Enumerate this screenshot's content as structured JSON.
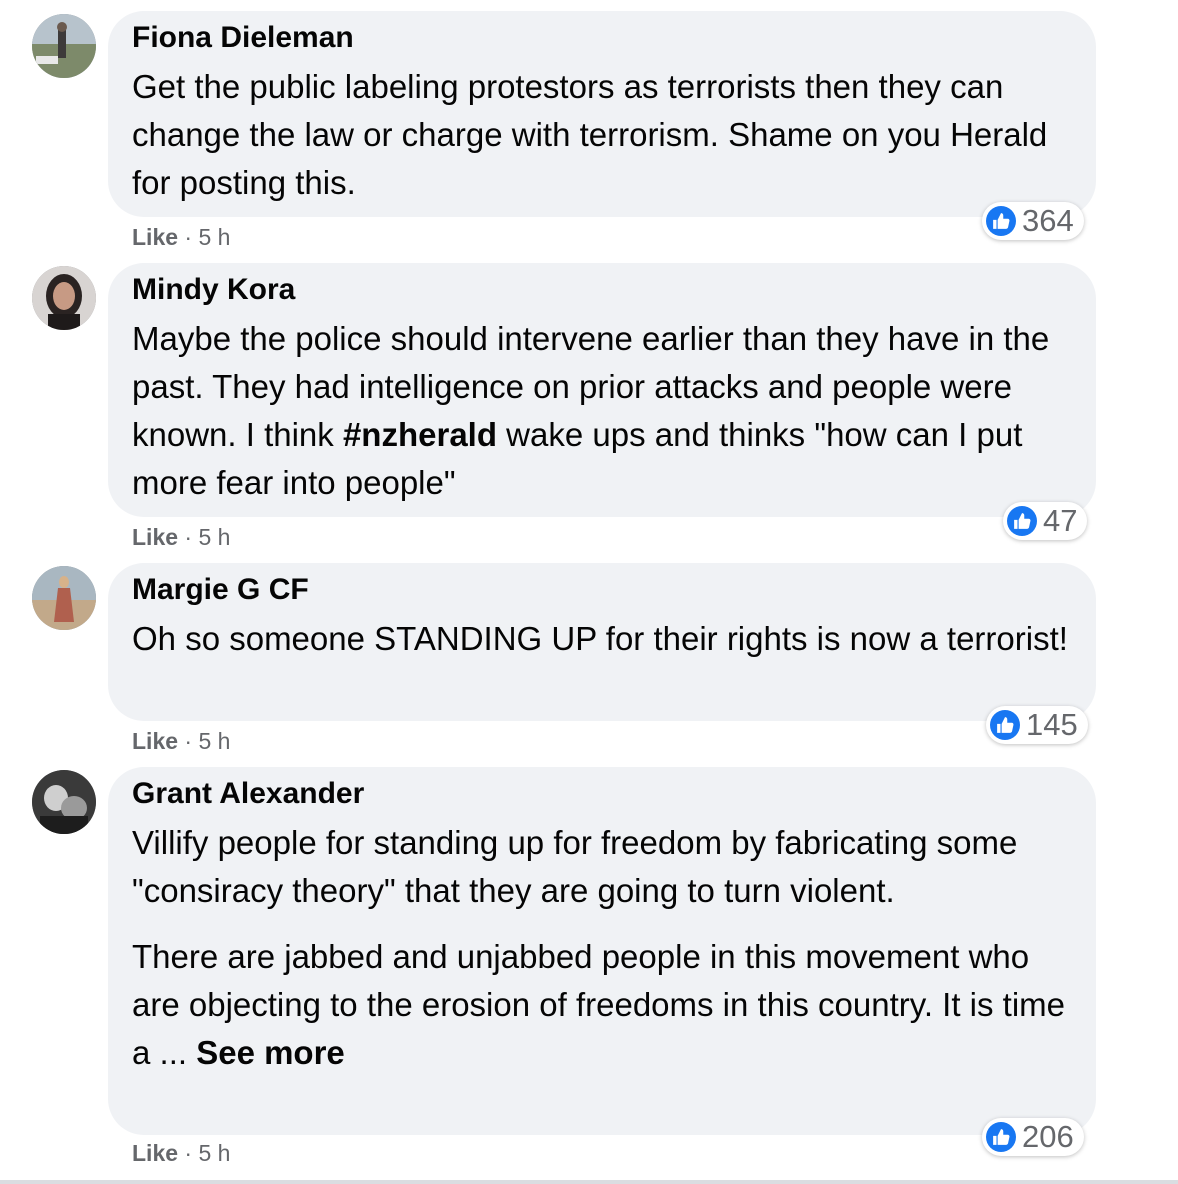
{
  "comments": [
    {
      "author": "Fiona Dieleman",
      "text": "Get the public labeling protestors as terrorists then they can change the law or charge with terrorism. Shame on you Herald for posting this.",
      "like_label": "Like",
      "separator": "·",
      "time": "5 h",
      "reaction_count": "364"
    },
    {
      "author": "Mindy Kora",
      "text_before": "Maybe the police should intervene earlier than they have in the past. They had intelligence on prior attacks and people were known. I think ",
      "hashtag": "#nzherald",
      "text_after": " wake ups and thinks \"how can I put more fear into people\"",
      "like_label": "Like",
      "separator": "·",
      "time": "5 h",
      "reaction_count": "47"
    },
    {
      "author": "Margie G CF",
      "text": "Oh so someone STANDING UP for their rights is now a terrorist!",
      "like_label": "Like",
      "separator": "·",
      "time": "5 h",
      "reaction_count": "145"
    },
    {
      "author": "Grant Alexander",
      "paragraph1": "Villify people for standing up for freedom by fabricating some \"consiracy theory\" that they are going to turn violent.",
      "paragraph2": "There are jabbed and unjabbed people in this movement who are objecting to the erosion of freedoms in this country. It is time a ... ",
      "see_more": "See more",
      "like_label": "Like",
      "separator": "·",
      "time": "5 h",
      "reaction_count": "206"
    }
  ],
  "icons": {
    "reaction": "thumbs-up-icon",
    "reaction_color": "#1877f2"
  }
}
